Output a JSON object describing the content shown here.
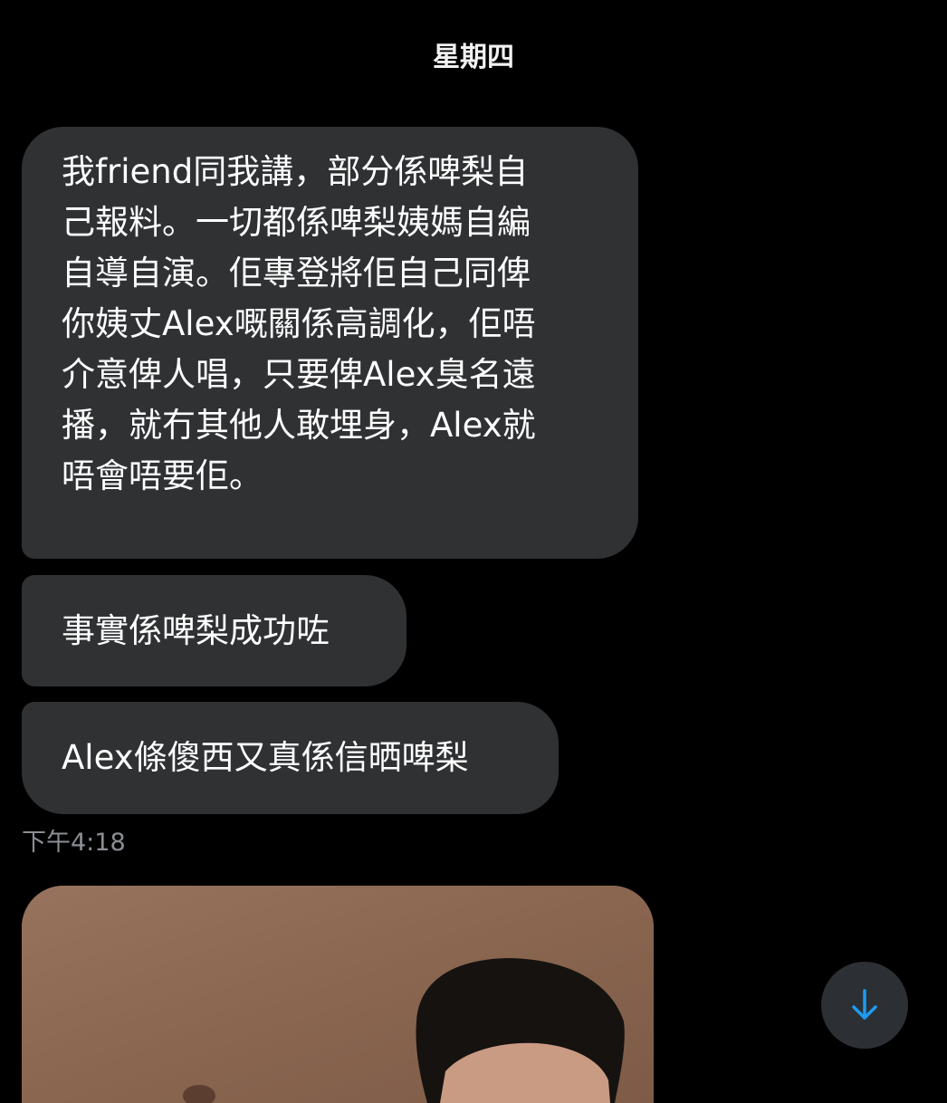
{
  "header": {
    "day_label": "星期四"
  },
  "messages": [
    {
      "text": "我friend同我講，部分係啤梨自\n己報料。一切都係啤梨姨媽自編\n自導自演。佢專登將佢自己同俾\n你姨丈Alex嘅關係高調化，佢唔\n介意俾人唱，只要俾Alex臭名遠\n播，就冇其他人敢埋身，Alex就\n唔會唔要佢。"
    },
    {
      "text": "事實係啤梨成功咗"
    },
    {
      "text": "Alex條傻西又真係信晒啤梨"
    }
  ],
  "timestamp": "下午4:18",
  "colors": {
    "background": "#000000",
    "bubble": "#2f3133",
    "timestamp": "#8b8f94",
    "accent": "#1d9bf0"
  },
  "icons": {
    "scroll_down": "arrow-down-icon"
  }
}
